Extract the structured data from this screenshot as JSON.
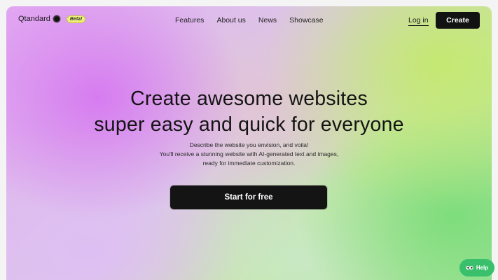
{
  "header": {
    "logo_text": "Qtandard",
    "beta_badge": "Beta!",
    "nav": [
      "Features",
      "About us",
      "News",
      "Showcase"
    ],
    "login_label": "Log in",
    "create_label": "Create"
  },
  "hero": {
    "headline_line1": "Create awesome websites",
    "headline_line2": "super easy and quick for everyone",
    "subtitle_line1": "Describe the website you envision, and voila!",
    "subtitle_line2": "You'll receive a stunning website with AI-generated text and images,",
    "subtitle_line3": "ready for immediate customization.",
    "cta_label": "Start for free"
  },
  "help": {
    "label": "Help",
    "icon": "eyes-icon",
    "color": "#3ac06c"
  },
  "colors": {
    "primary_button": "#121212",
    "beta_badge": "#eef27a"
  }
}
